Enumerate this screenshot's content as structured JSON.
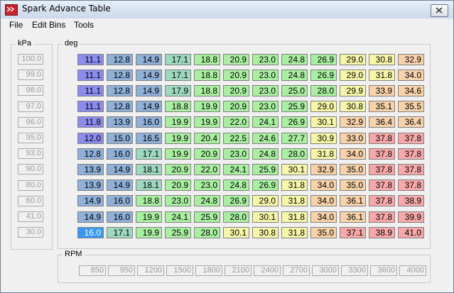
{
  "window": {
    "title": "Spark Advance Table"
  },
  "menu": [
    "File",
    "Edit Bins",
    "Tools"
  ],
  "groups": {
    "kpa_label": "kPa",
    "deg_label": "deg",
    "rpm_label": "RPM"
  },
  "kpa": [
    "100.0",
    "99.0",
    "98.0",
    "97.0",
    "96.0",
    "95.0",
    "93.0",
    "90.0",
    "80.0",
    "60.0",
    "41.0",
    "30.0"
  ],
  "rpm": [
    "850",
    "950",
    "1200",
    "1500",
    "1800",
    "2100",
    "2400",
    "2700",
    "3000",
    "3300",
    "3600",
    "4000"
  ],
  "table": [
    [
      "11.1",
      "12.8",
      "14.9",
      "17.1",
      "18.8",
      "20.9",
      "23.0",
      "24.8",
      "26.9",
      "29.0",
      "30.8",
      "32.9"
    ],
    [
      "11.1",
      "12.8",
      "14.9",
      "17.1",
      "18.8",
      "20.9",
      "23.0",
      "24.8",
      "26.9",
      "29.0",
      "31.8",
      "34.0"
    ],
    [
      "11.1",
      "12.8",
      "14.9",
      "17.9",
      "18.8",
      "20.9",
      "23.0",
      "25.0",
      "28.0",
      "29.9",
      "33.9",
      "34.6"
    ],
    [
      "11.1",
      "12.8",
      "14.9",
      "18.8",
      "19.9",
      "20.9",
      "23.0",
      "25.9",
      "29.0",
      "30.8",
      "35.1",
      "35.5"
    ],
    [
      "11.8",
      "13.9",
      "16.0",
      "19.9",
      "19.9",
      "22.0",
      "24.1",
      "26.9",
      "30.1",
      "32.9",
      "36.4",
      "36.4"
    ],
    [
      "12.0",
      "15.0",
      "16.5",
      "19.9",
      "20.4",
      "22.5",
      "24.6",
      "27.7",
      "30.9",
      "33.0",
      "37.8",
      "37.8"
    ],
    [
      "12.8",
      "16.0",
      "17.1",
      "19.9",
      "20.9",
      "23.0",
      "24.8",
      "28.0",
      "31.8",
      "34.0",
      "37.8",
      "37.8"
    ],
    [
      "13.9",
      "14.9",
      "18.1",
      "20.9",
      "22.0",
      "24.1",
      "25.9",
      "30.1",
      "32.9",
      "35.0",
      "37.8",
      "37.8"
    ],
    [
      "13.9",
      "14.9",
      "18.1",
      "20.9",
      "23.0",
      "24.8",
      "26.9",
      "31.8",
      "34.0",
      "35.0",
      "37.8",
      "37.8"
    ],
    [
      "14.9",
      "16.0",
      "18.8",
      "23.0",
      "24.8",
      "26.9",
      "29.0",
      "31.8",
      "34.0",
      "36.1",
      "37.8",
      "38.9"
    ],
    [
      "14.9",
      "16.0",
      "19.9",
      "24.1",
      "25.9",
      "28.0",
      "30.1",
      "31.8",
      "34.0",
      "36.1",
      "37.8",
      "39.9"
    ],
    [
      "16.0",
      "17.1",
      "19.9",
      "25.9",
      "28.0",
      "30.1",
      "30.8",
      "31.8",
      "35.0",
      "37.1",
      "38.9",
      "41.0"
    ]
  ],
  "selected_cell": {
    "row": 11,
    "col": 0
  },
  "colors": {
    "low": "#8c8cf0",
    "mid_blue": "#8fb0d8",
    "teal": "#9ed8c0",
    "green": "#a8f0a0",
    "yellow": "#f7f7a8",
    "orange": "#f8d2a8",
    "red": "#f8a8a8",
    "selected": "#3399ff"
  }
}
